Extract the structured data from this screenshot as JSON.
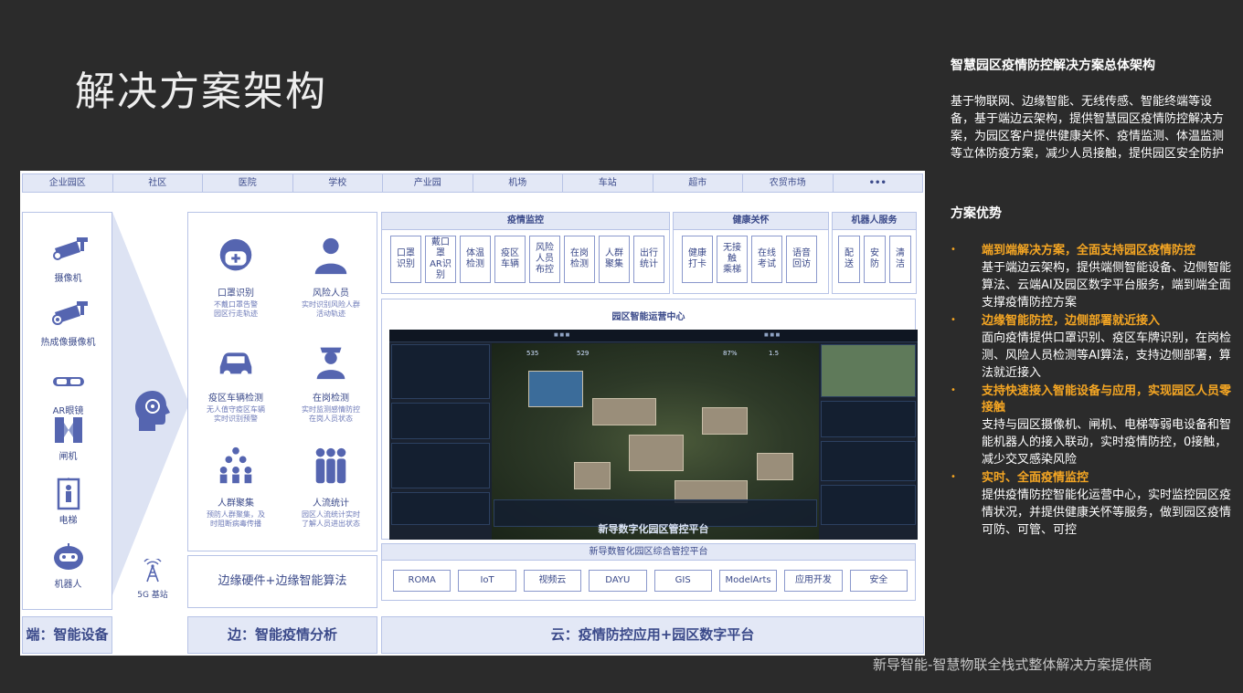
{
  "page": {
    "title": "解决方案架构",
    "footer": "新导智能-智慧物联全栈式整体解决方案提供商"
  },
  "diagram": {
    "scenarios": [
      "企业园区",
      "社区",
      "医院",
      "学校",
      "产业园",
      "机场",
      "车站",
      "超市",
      "农贸市场",
      "•••"
    ],
    "devices": [
      {
        "label": "摄像机",
        "icon": "camera-icon"
      },
      {
        "label": "热成像摄像机",
        "icon": "thermal-camera-icon"
      },
      {
        "label": "AR眼镜",
        "icon": "ar-glasses-icon"
      },
      {
        "label": "闸机",
        "icon": "gate-icon"
      },
      {
        "label": "电梯",
        "icon": "elevator-icon"
      },
      {
        "label": "机器人",
        "icon": "robot-icon"
      }
    ],
    "gateway_label": "5G 基站",
    "edge_ai": [
      {
        "name": "口罩识别",
        "desc": "不戴口罩告警\n园区行走轨迹",
        "icon": "mask-icon"
      },
      {
        "name": "风险人员",
        "desc": "实时识别风险人群\n活动轨迹",
        "icon": "person-icon"
      },
      {
        "name": "疫区车辆检测",
        "desc": "无人值守疫区车辆\n实时识别预警",
        "icon": "car-icon"
      },
      {
        "name": "在岗检测",
        "desc": "实时监测感情防控\n在岗人员状态",
        "icon": "guard-icon"
      },
      {
        "name": "人群聚集",
        "desc": "预防人群聚集，及\n时阻断病毒传播",
        "icon": "crowd-icon"
      },
      {
        "name": "人流统计",
        "desc": "园区人流统计实时\n了解人员进出状态",
        "icon": "people-count-icon"
      }
    ],
    "edge_footer": "边缘硬件+边缘智能算法",
    "monitor": {
      "title": "疫情监控",
      "items": [
        "口罩\n识别",
        "戴口罩\nAR识别",
        "体温\n检测",
        "疫区\n车辆",
        "风险\n人员\n布控",
        "在岗\n检测",
        "人群\n聚集",
        "出行\n统计"
      ]
    },
    "care": {
      "title": "健康关怀",
      "items": [
        "健康\n打卡",
        "无接触\n乘梯",
        "在线\n考试",
        "语音\n回访"
      ]
    },
    "robot": {
      "title": "机器人服务",
      "items": [
        "配\n送",
        "安\n防",
        "清\n洁"
      ]
    },
    "ops_center": {
      "title": "园区智能运营中心",
      "screen_title": "新导数字化园区管控平台",
      "stats": [
        "535",
        "529",
        "87%",
        "1.5"
      ]
    },
    "platform": {
      "title": "新导数智化园区综合管控平台",
      "services": [
        "ROMA",
        "IoT",
        "视频云",
        "DAYU",
        "GIS",
        "ModelArts",
        "应用开发",
        "安全"
      ]
    },
    "layers": {
      "end": "端：智能设备",
      "edge": "边：智能疫情分析",
      "cloud": "云：疫情防控应用+园区数字平台"
    }
  },
  "sidebar": {
    "heading": "智慧园区疫情防控解决方案总体架构",
    "intro": "基于物联网、边缘智能、无线传感、智能终端等设备，基于端边云架构，提供智慧园区疫情防控解决方案，为园区客户提供健康关怀、疫情监测、体温监测等立体防疫方案，减少人员接触，提供园区安全防护",
    "adv_heading": "方案优势",
    "advantages": [
      {
        "title": "端到端解决方案，全面支持园区疫情防控",
        "desc": "基于端边云架构，提供端侧智能设备、边侧智能算法、云端AI及园区数字平台服务，端到端全面支撑疫情防控方案"
      },
      {
        "title": "边缘智能防控，边侧部署就近接入",
        "desc": "面向疫情提供口罩识别、疫区车牌识别，在岗检测、风险人员检测等AI算法，支持边侧部署，算法就近接入"
      },
      {
        "title": "支持快速接入智能设备与应用，实现园区人员零接触",
        "desc": "支持与园区摄像机、闸机、电梯等弱电设备和智能机器人的接入联动，实时疫情防控，0接触，减少交叉感染风险"
      },
      {
        "title": "实时、全面疫情监控",
        "desc": "提供疫情防控智能化运营中心，实时监控园区疫情状况，并提供健康关怀等服务，做到园区疫情可防、可管、可控"
      }
    ]
  },
  "colors": {
    "accent": "#f5a623",
    "diagram_blue": "#3b4a8a",
    "icon_blue": "#5565b0",
    "background": "#2b2b2b"
  }
}
